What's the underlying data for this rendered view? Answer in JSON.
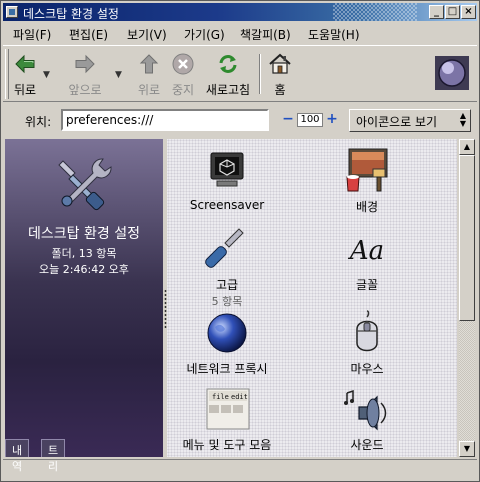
{
  "window": {
    "title": "데스크탑 환경 설정"
  },
  "titlebar_buttons": [
    {
      "name": "minimize-button",
      "glyph": "_"
    },
    {
      "name": "maximize-button",
      "glyph": "□"
    },
    {
      "name": "close-button",
      "glyph": "×"
    }
  ],
  "menu": {
    "file": "파일(F)",
    "edit": "편집(E)",
    "view": "보기(V)",
    "go": "가기(G)",
    "bookmarks": "책갈피(B)",
    "help": "도움말(H)"
  },
  "toolbar": {
    "back": "뒤로",
    "forward": "앞으로",
    "up": "위로",
    "stop": "중지",
    "reload": "새로고침",
    "home": "홈"
  },
  "location": {
    "label": "위치:",
    "value": "preferences:///",
    "zoom": "100",
    "view_mode": "아이콘으로 보기"
  },
  "sidebar": {
    "title": "데스크탑 환경 설정",
    "info_line1": "폴더, 13 항목",
    "info_line2": "오늘 2:46:42 오후",
    "tabs": [
      "내역",
      "트리"
    ]
  },
  "items": [
    {
      "label": "Screensaver",
      "sub": "",
      "icon": "screensaver-icon"
    },
    {
      "label": "배경",
      "sub": "",
      "icon": "background-icon"
    },
    {
      "label": "고급",
      "sub": "5 항목",
      "icon": "advanced-icon"
    },
    {
      "label": "글꼴",
      "sub": "",
      "icon": "font-icon"
    },
    {
      "label": "네트워크 프록시",
      "sub": "",
      "icon": "network-proxy-icon"
    },
    {
      "label": "마우스",
      "sub": "",
      "icon": "mouse-icon"
    },
    {
      "label": "메뉴 및 도구 모음",
      "sub": "",
      "icon": "menus-toolbars-icon"
    },
    {
      "label": "사운드",
      "sub": "",
      "icon": "sound-icon"
    }
  ],
  "menus_icon_text": [
    "file",
    "edit"
  ],
  "font_icon_text": "Aa"
}
